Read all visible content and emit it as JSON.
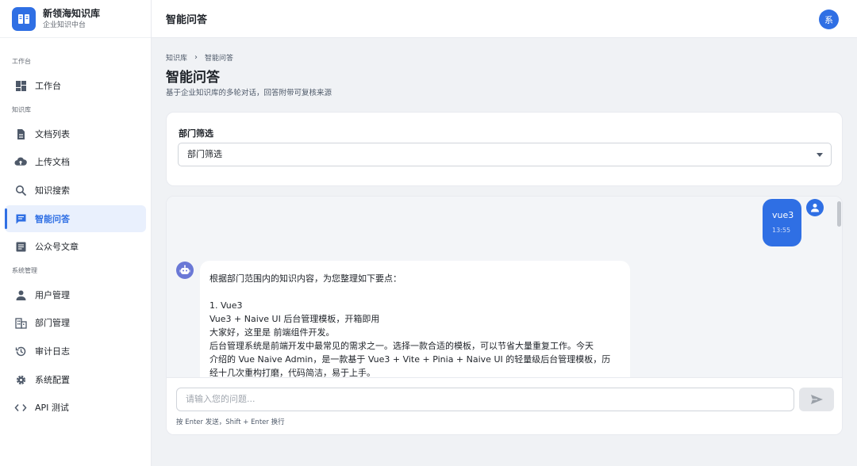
{
  "brand": {
    "title": "新领海知识库",
    "subtitle": "企业知识中台"
  },
  "sidebar": {
    "groups": [
      {
        "label": "工作台"
      },
      {
        "label": "知识库"
      },
      {
        "label": "系统管理"
      }
    ],
    "items": [
      {
        "label": "工作台",
        "icon": "dashboard-icon"
      },
      {
        "label": "文档列表",
        "icon": "document-icon"
      },
      {
        "label": "上传文档",
        "icon": "cloud-upload-icon"
      },
      {
        "label": "知识搜索",
        "icon": "search-icon"
      },
      {
        "label": "智能问答",
        "icon": "chat-icon",
        "active": true
      },
      {
        "label": "公众号文章",
        "icon": "article-icon"
      },
      {
        "label": "用户管理",
        "icon": "user-icon"
      },
      {
        "label": "部门管理",
        "icon": "building-icon"
      },
      {
        "label": "审计日志",
        "icon": "history-icon"
      },
      {
        "label": "系统配置",
        "icon": "gear-icon"
      },
      {
        "label": "API 测试",
        "icon": "code-icon"
      }
    ]
  },
  "header": {
    "title": "智能问答",
    "avatar_text": "系"
  },
  "breadcrumb": {
    "root": "知识库",
    "current": "智能问答"
  },
  "page": {
    "title": "智能问答",
    "description": "基于企业知识库的多轮对话，回答附带可复核来源"
  },
  "filter": {
    "label": "部门筛选",
    "selected": "部门筛选"
  },
  "chat": {
    "messages": [
      {
        "role": "user",
        "text": "vue3",
        "time": "13:55"
      },
      {
        "role": "assistant",
        "lines": [
          "根据部门范围内的知识内容，为您整理如下要点：",
          "",
          "1. Vue3",
          "Vue3 + Naive UI 后台管理模板，开箱即用",
          "大家好，这里是 前端组件开发。",
          "后台管理系统是前端开发中最常见的需求之一。选择一款合适的模板，可以节省大量重复工作。今天",
          "介绍的 Vue Naive Admin，是一款基于 Vue3 + Vite + Pinia + Naive UI 的轻量级后台管理模板，历",
          "经十几次重构打磨，代码简洁，易于上手。"
        ]
      }
    ],
    "input_placeholder": "请输入您的问题...",
    "hint": "按 Enter 发送，Shift + Enter 换行"
  },
  "colors": {
    "primary": "#2f6fe4",
    "active_bg": "#e9f0fd",
    "bot_avatar": "#6a78d6"
  }
}
